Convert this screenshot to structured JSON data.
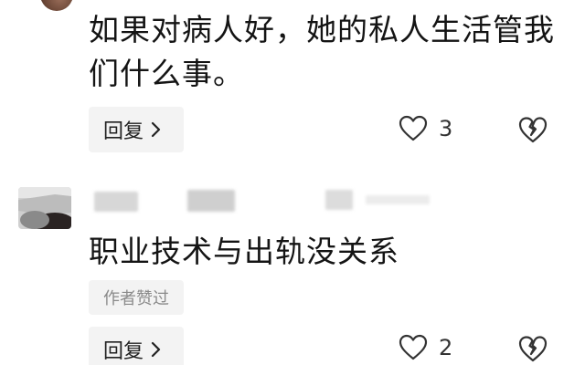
{
  "comments": [
    {
      "text": "如果对病人好，她的私人生活管我们什么事。",
      "reply_label": "回复",
      "like_count": "3",
      "icons": {
        "reply": "chevron-right-icon",
        "like": "heart-outline-icon",
        "dislike": "broken-heart-icon"
      }
    },
    {
      "text": "职业技术与出轨没关系",
      "author_tag": "作者赞过",
      "reply_label": "回复",
      "like_count": "2",
      "icons": {
        "reply": "chevron-right-icon",
        "like": "heart-outline-icon",
        "dislike": "broken-heart-icon"
      }
    }
  ],
  "colors": {
    "text": "#141414",
    "reply_bg": "#f3f3f3",
    "tag_text": "#8a8a8a",
    "icon_stroke": "#333333"
  }
}
